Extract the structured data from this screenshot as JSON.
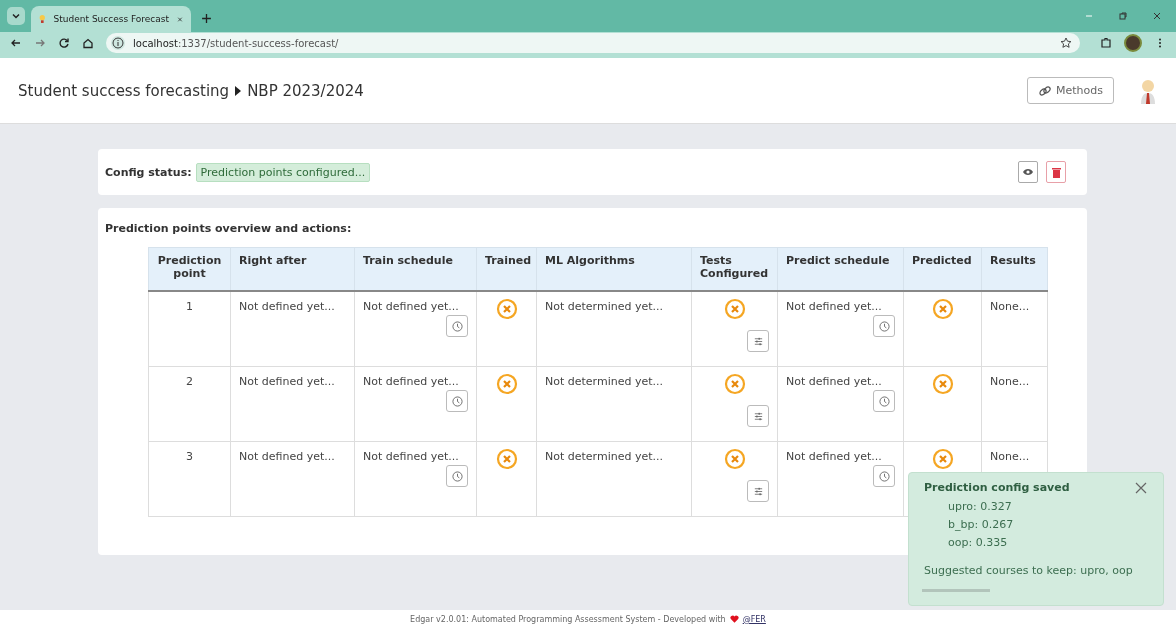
{
  "browser": {
    "tab_title": "Student Success Forecast",
    "url_host": "localhost",
    "url_path": ":1337/student-success-forecast/"
  },
  "header": {
    "title": "Student success forecasting",
    "subtitle": "NBP 2023/2024",
    "methods_button": "Methods"
  },
  "config": {
    "label": "Config status:",
    "status": "Prediction points configured..."
  },
  "overview": {
    "title": "Prediction points overview and actions:",
    "columns": [
      "Prediction point",
      "Right after",
      "Train schedule",
      "Trained",
      "ML Algorithms",
      "Tests Configured",
      "Predict schedule",
      "Predicted",
      "Results"
    ],
    "rows": [
      {
        "point": "1",
        "right_after": "Not defined yet...",
        "train_schedule": "Not defined yet...",
        "trained": false,
        "ml_algorithms": "Not determined yet...",
        "tests_configured": false,
        "predict_schedule": "Not defined yet...",
        "predicted": false,
        "results": "None..."
      },
      {
        "point": "2",
        "right_after": "Not defined yet...",
        "train_schedule": "Not defined yet...",
        "trained": false,
        "ml_algorithms": "Not determined yet...",
        "tests_configured": false,
        "predict_schedule": "Not defined yet...",
        "predicted": false,
        "results": "None..."
      },
      {
        "point": "3",
        "right_after": "Not defined yet...",
        "train_schedule": "Not defined yet...",
        "trained": false,
        "ml_algorithms": "Not determined yet...",
        "tests_configured": false,
        "predict_schedule": "Not defined yet...",
        "predicted": false,
        "results": "None..."
      }
    ]
  },
  "toast": {
    "title": "Prediction config saved",
    "lines": [
      "upro: 0.327",
      "b_bp: 0.267",
      "oop: 0.335"
    ],
    "message": "Suggested courses to keep: upro, oop"
  },
  "footer": {
    "text": "Edgar v2.0.01: Automated Programming Assessment System - Developed with",
    "link": "@FER"
  }
}
